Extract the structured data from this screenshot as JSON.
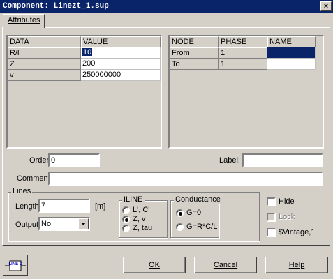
{
  "window": {
    "title": "Component: Linezt_1.sup",
    "close_icon": "×"
  },
  "tabs": [
    {
      "label": "Attributes"
    }
  ],
  "data_table": {
    "headers": [
      "DATA",
      "VALUE"
    ],
    "rows": [
      {
        "name": "R/l",
        "value": "10"
      },
      {
        "name": "Z",
        "value": "200"
      },
      {
        "name": "v",
        "value": "250000000"
      }
    ]
  },
  "node_table": {
    "headers": [
      "NODE",
      "PHASE",
      "NAME"
    ],
    "rows": [
      {
        "node": "From",
        "phase": "1",
        "name": ""
      },
      {
        "node": "To",
        "phase": "1",
        "name": ""
      }
    ]
  },
  "order": {
    "label": "Order:",
    "value": "0"
  },
  "label_field": {
    "label": "Label:",
    "value": ""
  },
  "comment": {
    "label": "Comment:",
    "value": ""
  },
  "lines": {
    "title": "Lines",
    "length_label": "Length",
    "length_value": "7",
    "length_unit": "[m]",
    "output_label": "Output",
    "output_value": "No"
  },
  "iline": {
    "title": "ILINE",
    "options": [
      "L', C'",
      "Z, v",
      "Z, tau"
    ],
    "selected": "Z, v"
  },
  "conductance": {
    "title": "Conductance",
    "options": [
      "G=0",
      "G=R*C/L"
    ],
    "selected": "G=0"
  },
  "checkboxes": {
    "hide": "Hide",
    "lock": "Lock",
    "vintage": "$Vintage,1"
  },
  "icon": {
    "text": "LINE Z"
  },
  "buttons": {
    "ok": "OK",
    "cancel": "Cancel",
    "help": "Help"
  }
}
